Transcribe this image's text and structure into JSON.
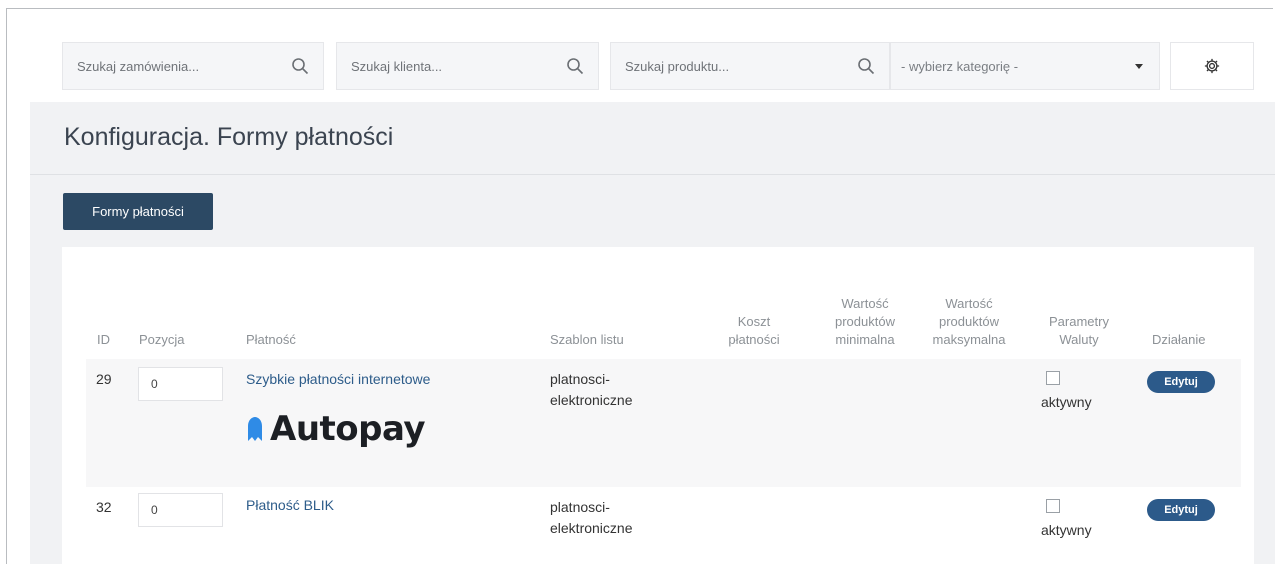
{
  "topbar": {
    "order_search": {
      "placeholder": "Szukaj zamówienia..."
    },
    "client_search": {
      "placeholder": "Szukaj klienta..."
    },
    "product_search": {
      "placeholder": "Szukaj produktu..."
    },
    "category_select": {
      "value": "- wybierz kategorię -"
    }
  },
  "page": {
    "title": "Konfiguracja. Formy płatności",
    "tab_button": "Formy płatności"
  },
  "table": {
    "headers": {
      "id": "ID",
      "position": "Pozycja",
      "payment": "Płatność",
      "list_template": "Szablon listu",
      "cost": [
        "Koszt",
        "płatności"
      ],
      "min_value": [
        "Wartość",
        "produktów",
        "minimalna"
      ],
      "max_value": [
        "Wartość",
        "produktów",
        "maksymalna"
      ],
      "currency_params": [
        "Parametry",
        "Waluty"
      ],
      "action": "Działanie"
    },
    "rows": [
      {
        "id": "29",
        "position": "0",
        "payment": "Szybkie płatności internetowe",
        "logo_text": "Autopay",
        "template": [
          "platnosci-",
          "elektroniczne"
        ],
        "active_label": "aktywny",
        "active": false,
        "edit_label": "Edytuj"
      },
      {
        "id": "32",
        "position": "0",
        "payment": "Płatność BLIK",
        "template": [
          "platnosci-",
          "elektroniczne"
        ],
        "active_label": "aktywny",
        "active": false,
        "edit_label": "Edytuj"
      }
    ]
  },
  "colors": {
    "primary_dark": "#2c4964",
    "link": "#2d5c8a",
    "button_pill": "#2c5a8a",
    "logo_blue": "#2f8be6"
  },
  "icons": {
    "search": "search-icon",
    "settings": "gear-icon",
    "dropdown": "chevron-down-icon",
    "logo": "autopay-logo-icon"
  }
}
